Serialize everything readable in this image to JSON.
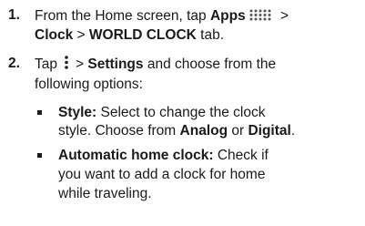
{
  "step1": {
    "number": "1.",
    "text_a": "From the Home screen, tap ",
    "apps": "Apps",
    "sep1": " > ",
    "clock": "Clock",
    "sep2": " > ",
    "world_clock": "WORLD CLOCK",
    "tab": " tab.",
    "apps_icon": "apps-grid-icon"
  },
  "step2": {
    "number": "2.",
    "tap": "Tap",
    "sep": "> ",
    "settings": "Settings",
    "text_b": " and choose from the",
    "text_c": "following options:",
    "menu_icon": "vertical-dots-menu-icon"
  },
  "options": [
    {
      "label": "Style:",
      "line1": " Select to change the clock",
      "line2a": "style. Choose from ",
      "analog": "Analog",
      "or": " or ",
      "digital": "Digital",
      "period": "."
    },
    {
      "label": "Automatic home clock:",
      "line1": " Check if",
      "line2": "you want to add a clock for home",
      "line3": "while traveling."
    }
  ]
}
